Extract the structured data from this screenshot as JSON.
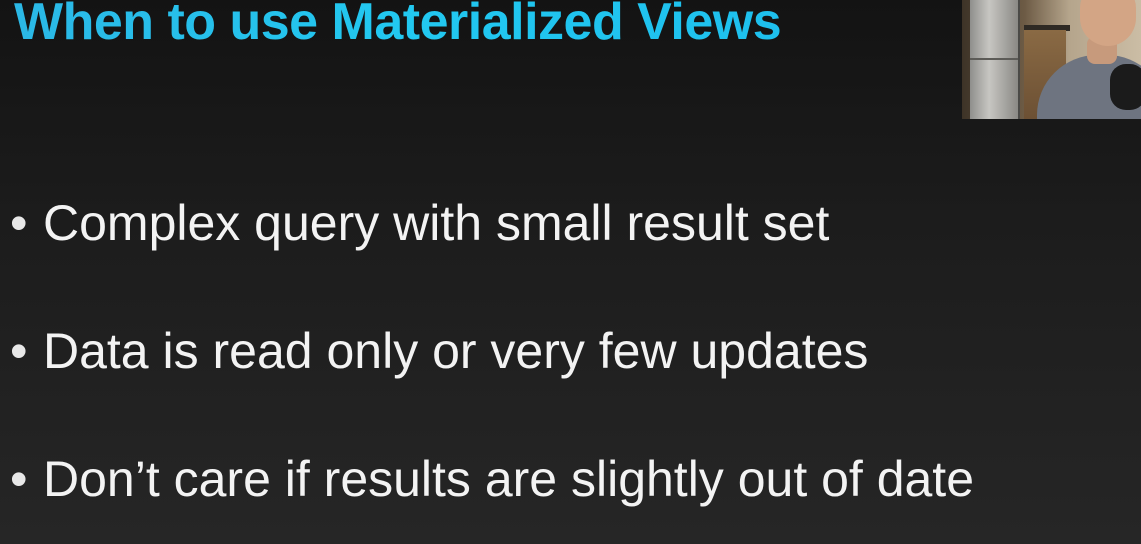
{
  "slide": {
    "title": "When to use Materialized Views",
    "bullets": [
      {
        "marker": "•",
        "text": "Complex query with small result set"
      },
      {
        "marker": "•",
        "text": "Data is read only or very few updates"
      },
      {
        "marker": "•",
        "text": "Don’t care if results are slightly out of date"
      }
    ]
  },
  "colors": {
    "title": "#22c8f0",
    "bullet_text": "#f3f3f3",
    "background_top": "#131313",
    "background_bottom": "#262626"
  },
  "webcam": {
    "icon": "presenter-webcam-feed"
  }
}
